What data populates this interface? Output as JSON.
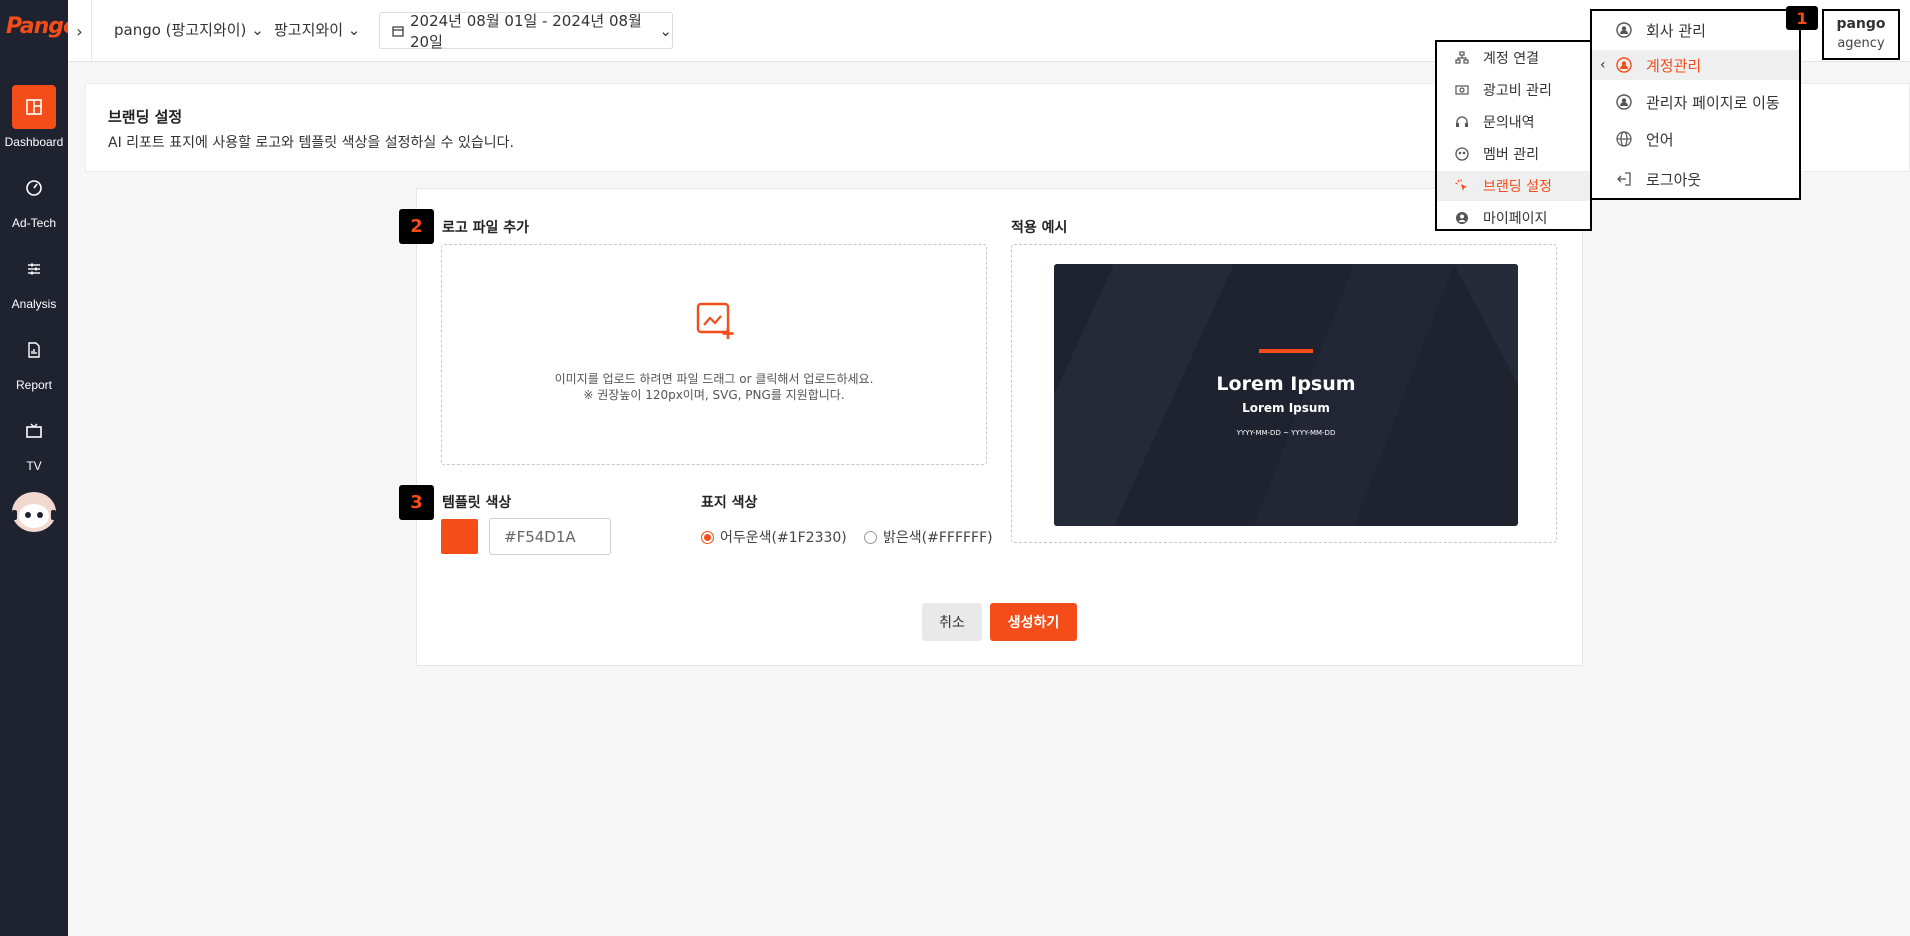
{
  "brand": {
    "logo_text": "Pango",
    "accent": "#F54D1A",
    "dark": "#1F2330"
  },
  "sidebar": {
    "items": [
      {
        "label": "Dashboard",
        "icon": "dashboard-icon",
        "active": true
      },
      {
        "label": "Ad-Tech",
        "icon": "gauge-icon",
        "active": false
      },
      {
        "label": "Analysis",
        "icon": "sliders-icon",
        "active": false
      },
      {
        "label": "Report",
        "icon": "report-icon",
        "active": false
      },
      {
        "label": "TV",
        "icon": "tv-icon",
        "active": false
      }
    ]
  },
  "topbar": {
    "account_select": "pango (팡고지와이)",
    "client_select": "팡고지와이",
    "date_range": "2024년 08월 01일 - 2024년 08월 20일"
  },
  "page": {
    "title": "브랜딩 설정",
    "description": "AI 리포트 표지에 사용할 로고와 템플릿 색상을 설정하실 수 있습니다."
  },
  "logo_section": {
    "label": "로고 파일 추가",
    "upload_line1": "이미지를 업로드 하려면 파일 드래그 or 클릭해서 업로드하세요.",
    "upload_line2": "※ 권장높이 120px이며, SVG, PNG를 지원합니다."
  },
  "preview_section": {
    "label": "적용 예시",
    "title": "Lorem Ipsum",
    "subtitle": "Lorem Ipsum",
    "date_placeholder": "YYYY-MM-DD ~ YYYY-MM-DD"
  },
  "template_color": {
    "label": "템플릿 색상",
    "value": "#F54D1A"
  },
  "display_color": {
    "label": "표지 색상",
    "options": [
      {
        "label": "어두운색(#1F2330)",
        "checked": true
      },
      {
        "label": "밝은색(#FFFFFF)",
        "checked": false
      }
    ]
  },
  "actions": {
    "cancel": "취소",
    "create": "생성하기"
  },
  "badges": [
    "1",
    "2",
    "3"
  ],
  "submenu": {
    "items": [
      {
        "label": "계정 연결",
        "icon": "network-icon"
      },
      {
        "label": "광고비 관리",
        "icon": "money-icon"
      },
      {
        "label": "문의내역",
        "icon": "headset-icon"
      },
      {
        "label": "멤버 관리",
        "icon": "members-icon"
      },
      {
        "label": "브랜딩 설정",
        "icon": "pointer-click-icon",
        "active": true
      },
      {
        "label": "마이페이지",
        "icon": "user-icon"
      }
    ]
  },
  "main_menu": {
    "items": [
      {
        "label": "회사 관리",
        "icon": "company-icon"
      },
      {
        "label": "계정관리",
        "icon": "account-icon",
        "active": true
      },
      {
        "label": "관리자 페이지로 이동",
        "icon": "admin-icon"
      },
      {
        "label": "언어",
        "icon": "globe-icon"
      },
      {
        "label": "로그아웃",
        "icon": "logout-icon"
      }
    ]
  },
  "profile": {
    "name": "pango",
    "role": "agency"
  }
}
